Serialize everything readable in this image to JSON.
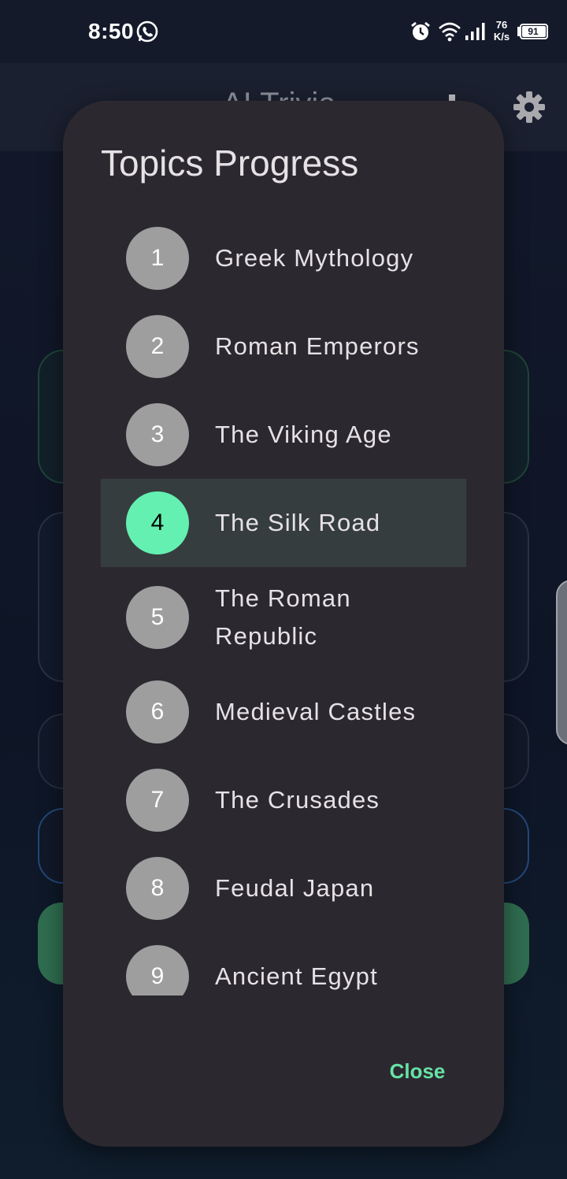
{
  "status_bar": {
    "time": "8:50",
    "net_speed_value": "76",
    "net_speed_unit": "K/s",
    "battery": "91",
    "icons": [
      "whatsapp-icon",
      "alarm-icon",
      "wifi-icon",
      "signal-icon",
      "battery-icon"
    ]
  },
  "app_bar": {
    "title": "AI Trivia",
    "settings_icon": "gear-icon"
  },
  "dialog": {
    "title": "Topics Progress",
    "topics": [
      {
        "number": "1",
        "label": "Greek Mythology"
      },
      {
        "number": "2",
        "label": "Roman Emperors"
      },
      {
        "number": "3",
        "label": "The Viking Age"
      },
      {
        "number": "4",
        "label": "The Silk Road"
      },
      {
        "number": "5",
        "label": "The Roman Republic"
      },
      {
        "number": "6",
        "label": "Medieval Castles"
      },
      {
        "number": "7",
        "label": "The Crusades"
      },
      {
        "number": "8",
        "label": "Feudal Japan"
      },
      {
        "number": "9",
        "label": "Ancient Egypt"
      }
    ],
    "selected_topic_number": "4",
    "close_label": "Close"
  },
  "colors": {
    "accent": "#64f0b0",
    "dialog_bg": "#2b292f",
    "selected_row_bg": "#363d3f",
    "inactive_badge": "#9e9e9e",
    "close_text": "#66e2a6"
  }
}
